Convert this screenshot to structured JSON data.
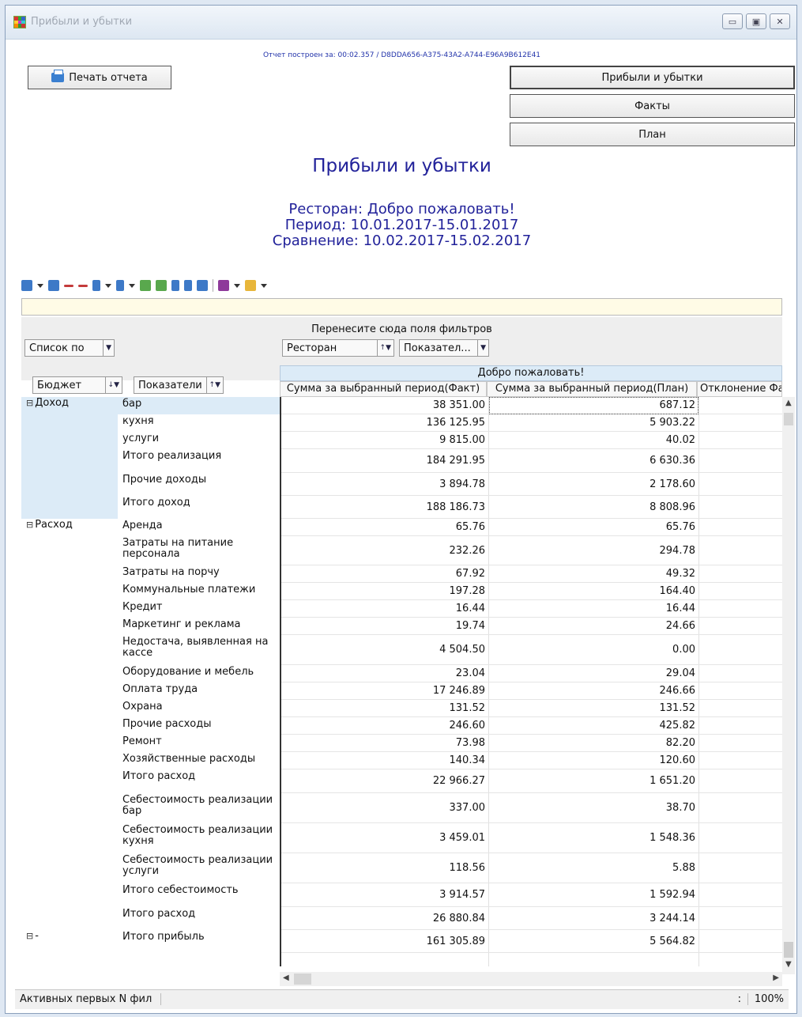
{
  "window": {
    "title": "Прибыли и убытки",
    "controls": [
      "minimize-icon",
      "maximize-icon",
      "close-icon"
    ]
  },
  "build_info": "Отчет построен за: 00:02.357 / D8DDA656-A375-43A2-A744-E96A9B612E41",
  "buttons": {
    "print": "Печать отчета",
    "report": "Прибыли и убытки",
    "facts": "Факты",
    "plan": "План"
  },
  "report": {
    "title": "Прибыли и убытки",
    "restaurant_line": "Ресторан: Добро пожаловать!",
    "period_line": "Период: 10.01.2017-15.01.2017",
    "compare_line": "Сравнение: 10.02.2017-15.02.2017"
  },
  "grid": {
    "filter_hint": "Перенесите сюда поля фильтров",
    "list_by": "Список по",
    "col_fields": {
      "restaurant": "Ресторан",
      "indicators": "Показател..."
    },
    "row_fields": {
      "budget": "Бюджет",
      "indicators": "Показатели"
    },
    "column_group": "Добро пожаловать!",
    "columns": [
      "Сумма за выбранный период(Факт)",
      "Сумма за выбранный период(План)",
      "Отклонение Фа"
    ],
    "categories": [
      {
        "symbol": "⊟",
        "label": "Доход"
      },
      {
        "symbol": "⊟",
        "label": "Расход"
      },
      {
        "symbol": "⊟",
        "label": "-"
      }
    ],
    "rows": [
      {
        "label": "бар",
        "fact": "38 351.00",
        "plan": "687.12"
      },
      {
        "label": "кухня",
        "fact": "136 125.95",
        "plan": "5 903.22"
      },
      {
        "label": "услуги",
        "fact": "9 815.00",
        "plan": "40.02"
      },
      {
        "label": "Итого реализация",
        "fact": "184 291.95",
        "plan": "6 630.36"
      },
      {
        "label": "Прочие доходы",
        "fact": "3 894.78",
        "plan": "2 178.60"
      },
      {
        "label": "Итого доход",
        "fact": "188 186.73",
        "plan": "8 808.96"
      },
      {
        "label": "Аренда",
        "fact": "65.76",
        "plan": "65.76"
      },
      {
        "label": "Затраты на питание персонала",
        "fact": "232.26",
        "plan": "294.78"
      },
      {
        "label": "Затраты на порчу",
        "fact": "67.92",
        "plan": "49.32"
      },
      {
        "label": "Коммунальные платежи",
        "fact": "197.28",
        "plan": "164.40"
      },
      {
        "label": "Кредит",
        "fact": "16.44",
        "plan": "16.44"
      },
      {
        "label": "Маркетинг и реклама",
        "fact": "19.74",
        "plan": "24.66"
      },
      {
        "label": "Недостача, выявленная на кассе",
        "fact": "4 504.50",
        "plan": "0.00"
      },
      {
        "label": "Оборудование и мебель",
        "fact": "23.04",
        "plan": "29.04"
      },
      {
        "label": "Оплата труда",
        "fact": "17 246.89",
        "plan": "246.66"
      },
      {
        "label": "Охрана",
        "fact": "131.52",
        "plan": "131.52"
      },
      {
        "label": "Прочие расходы",
        "fact": "246.60",
        "plan": "425.82"
      },
      {
        "label": "Ремонт",
        "fact": "73.98",
        "plan": "82.20"
      },
      {
        "label": "Хозяйственные расходы",
        "fact": "140.34",
        "plan": "120.60"
      },
      {
        "label": "Итого расход",
        "fact": "22 966.27",
        "plan": "1 651.20"
      },
      {
        "label": "Себестоимость реализации бар",
        "fact": "337.00",
        "plan": "38.70"
      },
      {
        "label": "Себестоимость реализации кухня",
        "fact": "3 459.01",
        "plan": "1 548.36"
      },
      {
        "label": "Себестоимость реализации услуги",
        "fact": "118.56",
        "plan": "5.88"
      },
      {
        "label": "Итого себестоимость",
        "fact": "3 914.57",
        "plan": "1 592.94"
      },
      {
        "label": "Итого расход",
        "fact": "26 880.84",
        "plan": "3 244.14"
      },
      {
        "label": "Итого прибыль",
        "fact": "161 305.89",
        "plan": "5 564.82"
      }
    ]
  },
  "status": {
    "left": "Активных первых N фил",
    "mid": ":",
    "zoom": "100%"
  }
}
